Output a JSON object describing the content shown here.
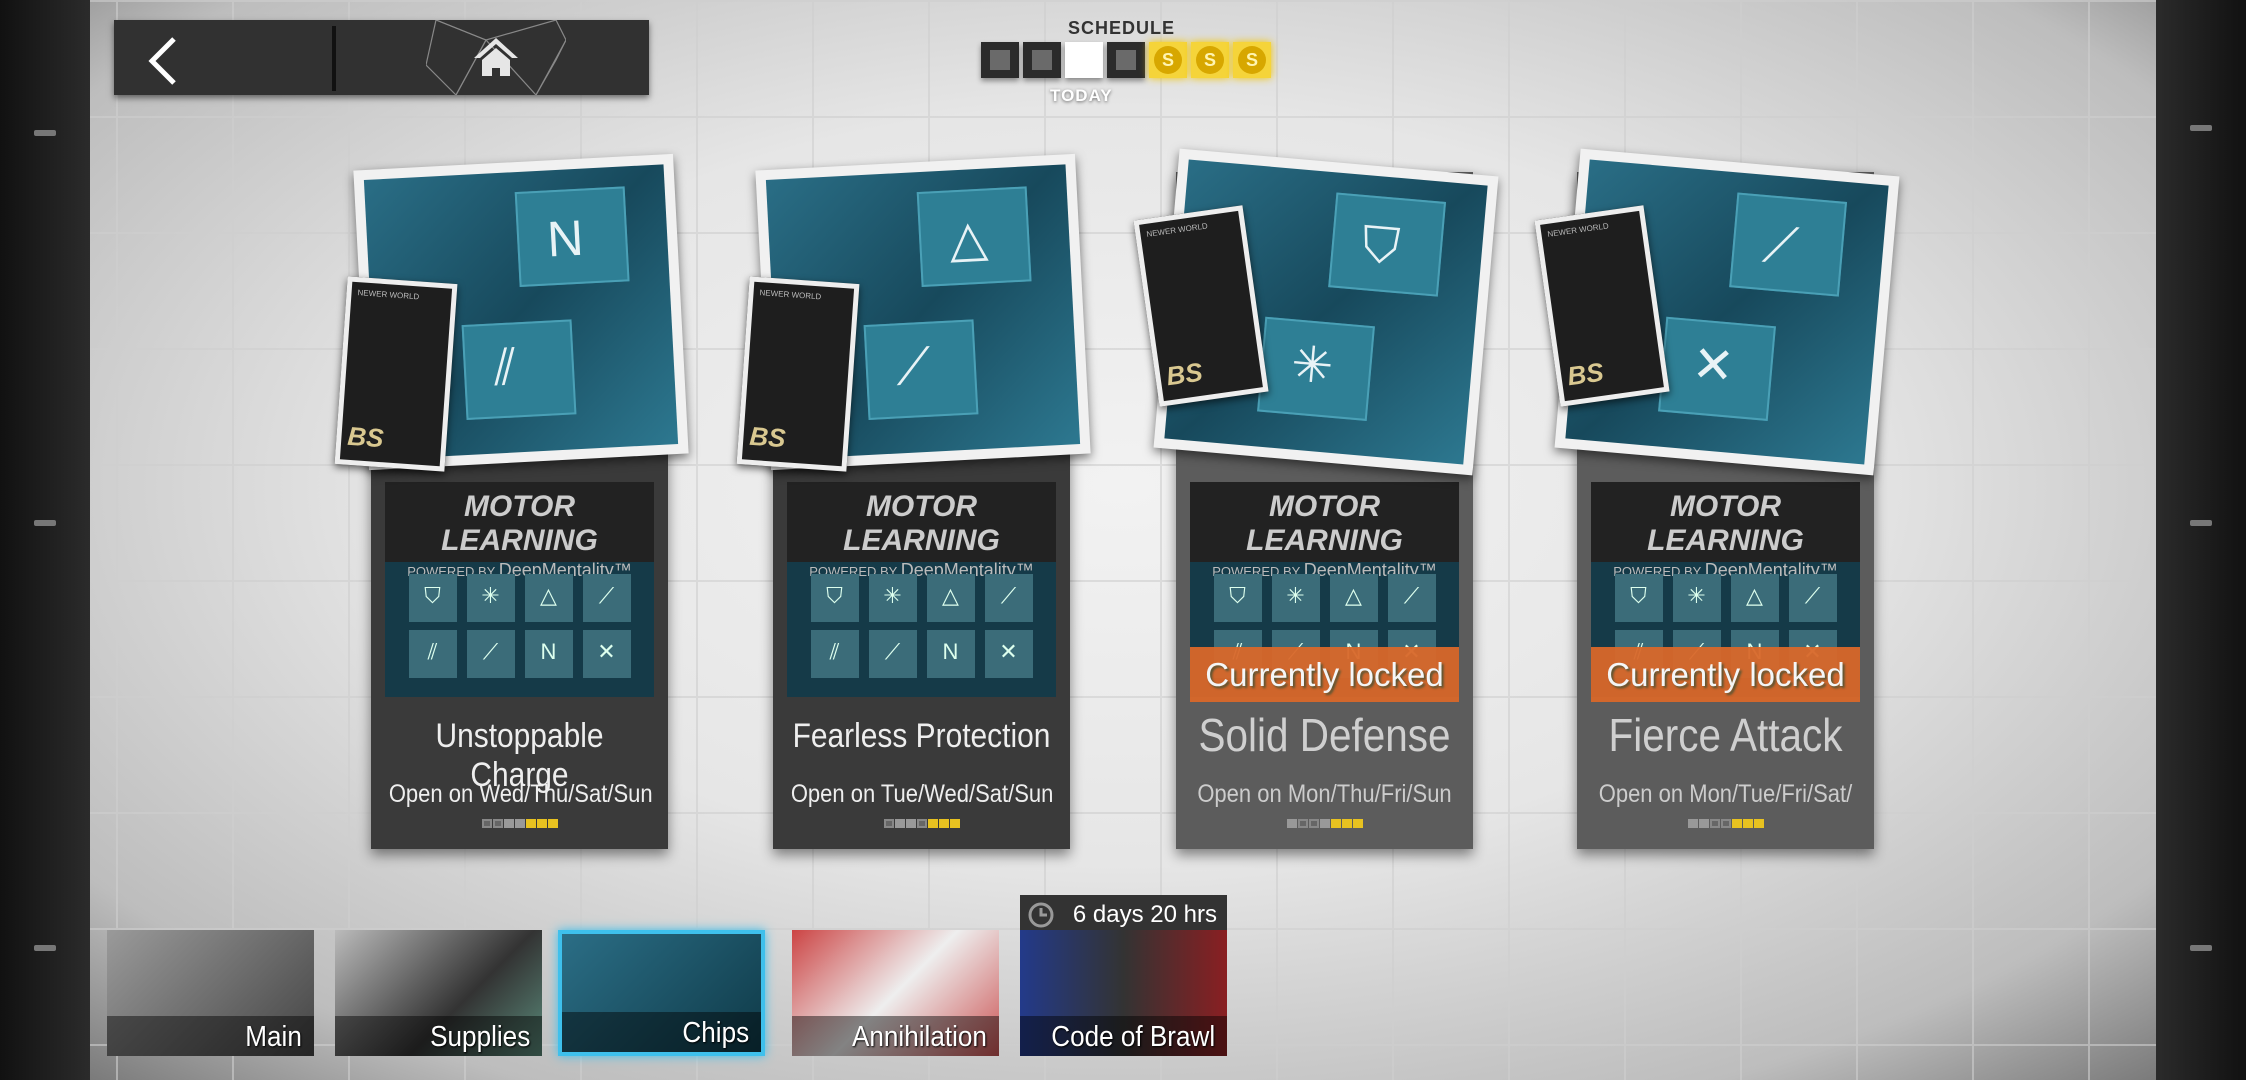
{
  "nav": {
    "back_icon": "chevron-left-icon",
    "home_icon": "home-icon"
  },
  "schedule": {
    "title": "SCHEDULE",
    "today_label": "TODAY",
    "days": [
      "closed",
      "closed",
      "today",
      "closed",
      "supply",
      "supply",
      "supply"
    ],
    "supply_glyph": "S"
  },
  "colors": {
    "accent_yellow": "#f5d43a",
    "locked_orange": "#d9682a",
    "active_tab": "#3ec0ec"
  },
  "cards": [
    {
      "banner_title": "MOTOR LEARNING",
      "banner_sub": "POWERED BY",
      "banner_brand": "DeepMentality™",
      "name": "Unstoppable Charge",
      "open": "Open on Wed/Thu/Sat/Sun",
      "locked": false,
      "days": [
        "d",
        "d",
        "g",
        "g",
        "y",
        "y",
        "y"
      ]
    },
    {
      "banner_title": "MOTOR LEARNING",
      "banner_sub": "POWERED BY",
      "banner_brand": "DeepMentality™",
      "name": "Fearless Protection",
      "open": "Open on Tue/Wed/Sat/Sun",
      "locked": false,
      "days": [
        "d",
        "g",
        "g",
        "d",
        "y",
        "y",
        "y"
      ]
    },
    {
      "banner_title": "MOTOR LEARNING",
      "banner_sub": "POWERED BY",
      "banner_brand": "DeepMentality™",
      "name": "Solid Defense",
      "open": "Open on Mon/Thu/Fri/Sun",
      "locked": true,
      "lock_text": "Currently locked",
      "days": [
        "g",
        "d",
        "d",
        "g",
        "y",
        "y",
        "y"
      ]
    },
    {
      "banner_title": "MOTOR LEARNING",
      "banner_sub": "POWERED BY",
      "banner_brand": "DeepMentality™",
      "name": "Fierce Attack",
      "open": "Open on Mon/Tue/Fri/Sat/",
      "locked": true,
      "lock_text": "Currently locked",
      "days": [
        "g",
        "g",
        "d",
        "d",
        "y",
        "y",
        "y"
      ]
    }
  ],
  "tabs": [
    {
      "label": "Main"
    },
    {
      "label": "Supplies"
    },
    {
      "label": "Chips",
      "active": true
    },
    {
      "label": "Annihilation"
    },
    {
      "label": "Code of Brawl",
      "timer": "6 days 20 hrs"
    }
  ]
}
